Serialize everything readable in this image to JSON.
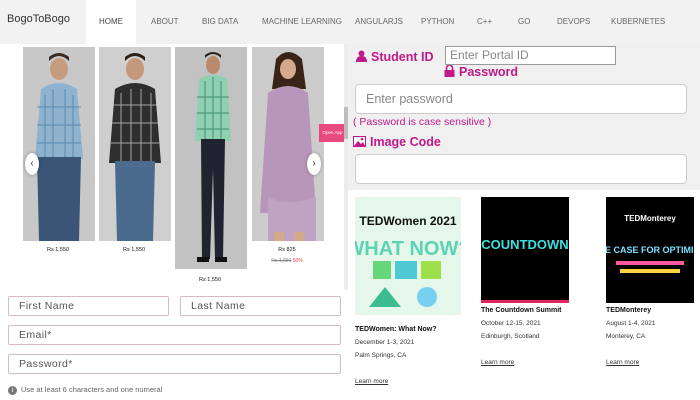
{
  "nav": {
    "brand": "BogoToBogo",
    "items": [
      {
        "label": "HOME",
        "active": true
      },
      {
        "label": "ABOUT"
      },
      {
        "label": "BIG DATA"
      },
      {
        "label": "MACHINE LEARNING"
      },
      {
        "label": "ANGULARJS"
      },
      {
        "label": "PYTHON"
      },
      {
        "label": "C++"
      },
      {
        "label": "GO"
      },
      {
        "label": "DEVOPS"
      },
      {
        "label": "KUBERNETES"
      }
    ]
  },
  "carousel": {
    "prev_icon": "‹",
    "next_icon": "›",
    "open_app_label": "Open App",
    "products": [
      {
        "price": "Rs 1,550",
        "shirt_color": "light-blue-check"
      },
      {
        "price": "Rs 1,550",
        "shirt_color": "black-check"
      },
      {
        "price": "Rs 1,550",
        "shirt_color": "green-check"
      },
      {
        "price": "Rs 825",
        "old_price": "Rs 1,650",
        "discount": "50%",
        "shirt_color": "lavender"
      }
    ]
  },
  "signup": {
    "first_name": "First Name",
    "last_name": "Last Name",
    "email": "Email*",
    "password": "Password*",
    "hint": "Use at least 6 characters and one numeral"
  },
  "login": {
    "student_id_label": "Student ID",
    "portal_placeholder": "Enter Portal ID",
    "password_label": "Password",
    "password_placeholder": "Enter password",
    "case_note": "( Password is case sensitive )",
    "image_code_label": "Image Code",
    "accent_color": "#c0198a"
  },
  "events": [
    {
      "thumb_text": "TEDWomen 2021",
      "thumb_text2": "WHAT NOW?",
      "title": "TEDWomen: What Now?",
      "dates": "December 1-3, 2021",
      "place": "Palm Springs, CA",
      "link": "Learn more"
    },
    {
      "thumb_text": "COUNTDOWN",
      "title": "The Countdown Summit",
      "dates": "October 12-15, 2021",
      "place": "Edinburgh, Scotland",
      "link": "Learn more"
    },
    {
      "thumb_text": "TEDMonterey",
      "thumb_text2": "THE CASE FOR OPTIMISM",
      "title": "TEDMonterey",
      "dates": "August 1-4, 2021",
      "place": "Monterey, CA",
      "link": "Learn more"
    }
  ]
}
